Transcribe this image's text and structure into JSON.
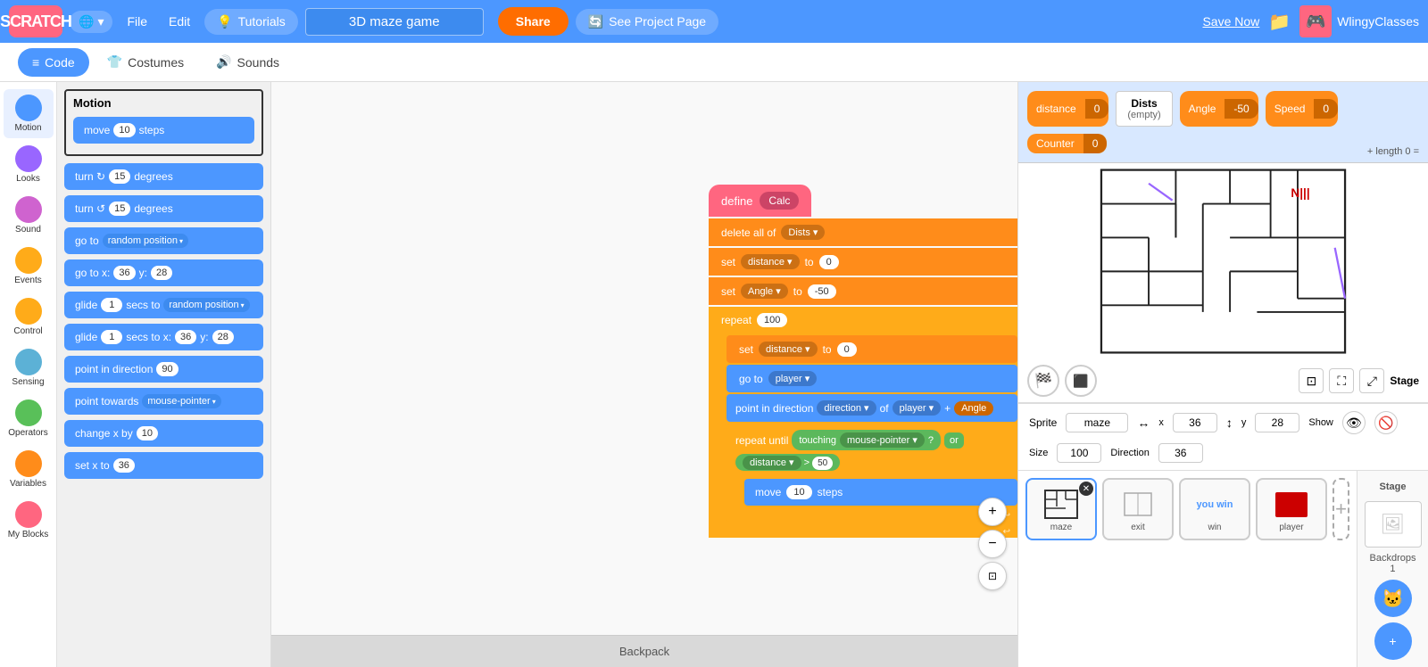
{
  "topbar": {
    "logo": "SCRATCH",
    "globe_label": "🌐",
    "file_label": "File",
    "edit_label": "Edit",
    "tutorials_label": "Tutorials",
    "tutorials_icon": "💡",
    "project_name": "3D maze game",
    "share_label": "Share",
    "remix_icon": "🔄",
    "see_project_label": "See Project Page",
    "save_now_label": "Save Now",
    "folder_icon": "📁",
    "user_icon": "🎮",
    "user_name": "WlingyClasses"
  },
  "tabs": {
    "code_label": "Code",
    "costumes_label": "Costumes",
    "sounds_label": "Sounds",
    "code_icon": "≡",
    "costumes_icon": "👕",
    "sounds_icon": "🔊"
  },
  "categories": [
    {
      "id": "motion",
      "label": "Motion",
      "color": "#4c97ff"
    },
    {
      "id": "looks",
      "label": "Looks",
      "color": "#9966ff"
    },
    {
      "id": "sound",
      "label": "Sound",
      "color": "#cf63cf"
    },
    {
      "id": "events",
      "label": "Events",
      "color": "#ffab19"
    },
    {
      "id": "control",
      "label": "Control",
      "color": "#ffab19"
    },
    {
      "id": "sensing",
      "label": "Sensing",
      "color": "#5cb1d6"
    },
    {
      "id": "operators",
      "label": "Operators",
      "color": "#59c059"
    },
    {
      "id": "variables",
      "label": "Variables",
      "color": "#ff8c1a"
    },
    {
      "id": "my_blocks",
      "label": "My Blocks",
      "color": "#ff6680"
    }
  ],
  "blocks_panel": {
    "section_title": "Motion",
    "blocks": [
      {
        "label": "move",
        "value": "10",
        "suffix": "steps"
      },
      {
        "label": "turn ↻",
        "value": "15",
        "suffix": "degrees"
      },
      {
        "label": "turn ↺",
        "value": "15",
        "suffix": "degrees"
      },
      {
        "label": "go to",
        "dropdown": "random position"
      },
      {
        "label": "go to x:",
        "x": "36",
        "y_label": "y:",
        "y": "28"
      },
      {
        "label": "glide",
        "value": "1",
        "mid": "secs to",
        "dropdown": "random position"
      },
      {
        "label": "glide",
        "value": "1",
        "mid": "secs to x:",
        "x": "36",
        "y_label": "y:",
        "y": "28"
      },
      {
        "label": "point in direction",
        "value": "90"
      },
      {
        "label": "point towards",
        "dropdown": "mouse-pointer"
      },
      {
        "label": "change x by",
        "value": "10"
      },
      {
        "label": "set x to",
        "value": "36"
      }
    ]
  },
  "canvas_blocks": {
    "define_block": "define  Calc",
    "delete_all_of": "delete all of",
    "delete_list": "Dists",
    "set_distance_to": "set  distance  to  0",
    "set_angle_to": "set  Angle  to  -50",
    "repeat_count": "100",
    "set_dist_inner": "set  distance  to  0",
    "go_to": "go to",
    "go_to_target": "player",
    "point_dir": "point in direction",
    "point_direction_of": "direction",
    "point_of": "of",
    "point_player": "player",
    "point_plus": "+",
    "point_angle": "Angle",
    "repeat_until_label": "repeat until",
    "touching_label": "touching",
    "mouse_pointer": "mouse-pointer",
    "question_mark": "?",
    "or_label": "or",
    "distance_label": "distance",
    "gt_label": ">",
    "dist_value": "50",
    "move_inner": "move",
    "move_steps_val": "10",
    "move_steps_label": "steps"
  },
  "backpack": {
    "label": "Backpack"
  },
  "variables": [
    {
      "name": "distance",
      "value": "0",
      "color": "#ff8c1a"
    },
    {
      "name": "Angle",
      "value": "-50",
      "color": "#ff8c1a"
    },
    {
      "name": "Speed",
      "value": "0",
      "color": "#ff8c1a"
    },
    {
      "name": "Counter",
      "value": "0",
      "color": "#ff8c1a"
    }
  ],
  "dists_panel": {
    "title": "Dists",
    "content": "(empty)",
    "formula": "+ length 0 ="
  },
  "stage_controls": {
    "green_flag": "▶",
    "stop": "⬛",
    "stage_label": "Stage",
    "full_screen": "⛶",
    "small_screen": "⊡"
  },
  "sprite_info": {
    "sprite_label": "Sprite",
    "sprite_name": "maze",
    "x_label": "x",
    "x_value": "36",
    "y_label": "y",
    "y_value": "28",
    "show_label": "Show",
    "size_label": "Size",
    "size_value": "100",
    "direction_label": "Direction",
    "direction_value": "36"
  },
  "sprites": [
    {
      "name": "maze",
      "active": true,
      "has_delete": true
    },
    {
      "name": "exit",
      "active": false
    },
    {
      "name": "win",
      "active": false
    },
    {
      "name": "player",
      "active": false,
      "color": "#cc0000"
    }
  ],
  "stage_right": {
    "label": "Stage",
    "backdrops_label": "Backdrops",
    "count": "1"
  },
  "zoom": {
    "in": "+",
    "out": "−",
    "fit": "⊡"
  }
}
